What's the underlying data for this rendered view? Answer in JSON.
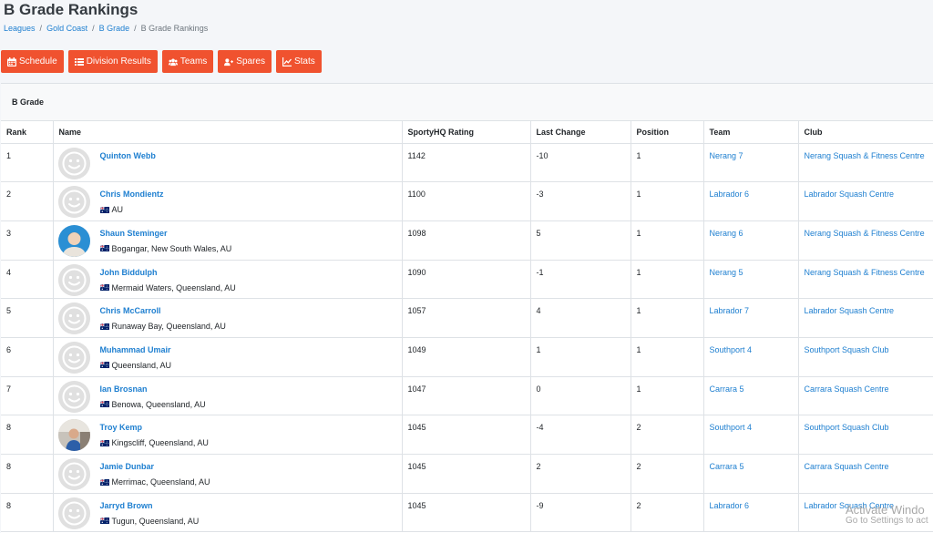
{
  "page": {
    "title": "B Grade Rankings"
  },
  "breadcrumb": {
    "items": [
      "Leagues",
      "Gold Coast",
      "B Grade"
    ],
    "current": "B Grade Rankings"
  },
  "toolbar": {
    "buttons": [
      {
        "label": "Schedule",
        "icon": "calendar-icon"
      },
      {
        "label": "Division Results",
        "icon": "list-icon"
      },
      {
        "label": "Teams",
        "icon": "users-icon"
      },
      {
        "label": "Spares",
        "icon": "user-plus-icon"
      },
      {
        "label": "Stats",
        "icon": "chart-line-icon"
      }
    ]
  },
  "card": {
    "title": "B Grade"
  },
  "table": {
    "headers": [
      "Rank",
      "Name",
      "SportyHQ Rating",
      "Last Change",
      "Position",
      "Team",
      "Club"
    ],
    "rows": [
      {
        "rank": "1",
        "name": "Quinton Webb",
        "location": "",
        "rating": "1142",
        "change": "-10",
        "position": "1",
        "team": "Nerang 7",
        "club": "Nerang Squash & Fitness Centre",
        "avatar": "default"
      },
      {
        "rank": "2",
        "name": "Chris Mondientz",
        "location": "AU",
        "rating": "1100",
        "change": "-3",
        "position": "1",
        "team": "Labrador 6",
        "club": "Labrador Squash Centre",
        "avatar": "default"
      },
      {
        "rank": "3",
        "name": "Shaun Steminger",
        "location": "Bogangar, New South Wales, AU",
        "rating": "1098",
        "change": "5",
        "position": "1",
        "team": "Nerang 6",
        "club": "Nerang Squash & Fitness Centre",
        "avatar": "photo-a"
      },
      {
        "rank": "4",
        "name": "John Biddulph",
        "location": "Mermaid Waters, Queensland, AU",
        "rating": "1090",
        "change": "-1",
        "position": "1",
        "team": "Nerang 5",
        "club": "Nerang Squash & Fitness Centre",
        "avatar": "default"
      },
      {
        "rank": "5",
        "name": "Chris McCarroll",
        "location": "Runaway Bay, Queensland, AU",
        "rating": "1057",
        "change": "4",
        "position": "1",
        "team": "Labrador 7",
        "club": "Labrador Squash Centre",
        "avatar": "default"
      },
      {
        "rank": "6",
        "name": "Muhammad Umair",
        "location": "Queensland, AU",
        "rating": "1049",
        "change": "1",
        "position": "1",
        "team": "Southport 4",
        "club": "Southport Squash Club",
        "avatar": "default"
      },
      {
        "rank": "7",
        "name": "Ian Brosnan",
        "location": "Benowa, Queensland, AU",
        "rating": "1047",
        "change": "0",
        "position": "1",
        "team": "Carrara 5",
        "club": "Carrara Squash Centre",
        "avatar": "default"
      },
      {
        "rank": "8",
        "name": "Troy Kemp",
        "location": "Kingscliff, Queensland, AU",
        "rating": "1045",
        "change": "-4",
        "position": "2",
        "team": "Southport 4",
        "club": "Southport Squash Club",
        "avatar": "photo-b"
      },
      {
        "rank": "8",
        "name": "Jamie Dunbar",
        "location": "Merrimac, Queensland, AU",
        "rating": "1045",
        "change": "2",
        "position": "2",
        "team": "Carrara 5",
        "club": "Carrara Squash Centre",
        "avatar": "default"
      },
      {
        "rank": "8",
        "name": "Jarryd Brown",
        "location": "Tugun, Queensland, AU",
        "rating": "1045",
        "change": "-9",
        "position": "2",
        "team": "Labrador 6",
        "club": "Labrador Squash Centre",
        "avatar": "default"
      }
    ]
  },
  "watermark": {
    "line1": "Activate Windo",
    "line2": "Go to Settings to act"
  },
  "colors": {
    "accent": "#f0522f",
    "link": "#1e7fd0"
  }
}
